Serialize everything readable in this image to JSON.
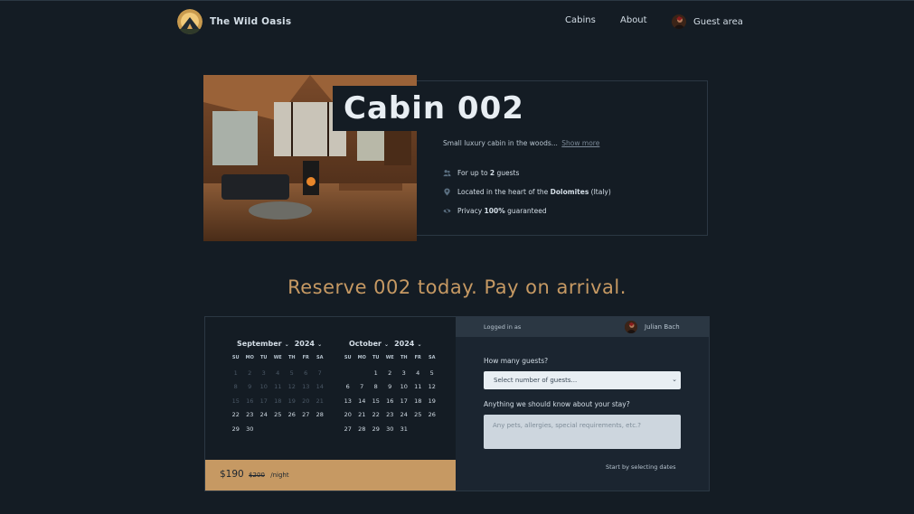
{
  "header": {
    "app_name": "The Wild Oasis",
    "nav": [
      "Cabins",
      "About"
    ],
    "guest_area": "Guest area"
  },
  "cabin": {
    "name": "Cabin 002",
    "description": "Small luxury cabin in the woods...",
    "show_more": "Show more",
    "features": [
      {
        "icon": "users-icon",
        "pre": "For up to ",
        "bold": "2",
        "post": " guests"
      },
      {
        "icon": "map-pin-icon",
        "pre": "Located in the heart of the ",
        "bold": "Dolomites",
        "post": " (Italy)"
      },
      {
        "icon": "eye-slash-icon",
        "pre": "Privacy ",
        "bold": "100%",
        "post": " guaranteed"
      }
    ]
  },
  "reserve_heading": "Reserve 002 today. Pay on arrival.",
  "calendar": {
    "weekdays": [
      "SU",
      "MO",
      "TU",
      "WE",
      "TH",
      "FR",
      "SA"
    ],
    "months": [
      {
        "month": "September",
        "year": "2024",
        "rows": [
          [
            "1",
            "2",
            "3",
            "4",
            "5",
            "6",
            "7"
          ],
          [
            "8",
            "9",
            "10",
            "11",
            "12",
            "13",
            "14"
          ],
          [
            "15",
            "16",
            "17",
            "18",
            "19",
            "20",
            "21"
          ],
          [
            "22",
            "23",
            "24",
            "25",
            "26",
            "27",
            "28"
          ],
          [
            "29",
            "30",
            "",
            "",
            "",
            "",
            ""
          ]
        ],
        "past_until": 21
      },
      {
        "month": "October",
        "year": "2024",
        "rows": [
          [
            "",
            "",
            "1",
            "2",
            "3",
            "4",
            "5"
          ],
          [
            "6",
            "7",
            "8",
            "9",
            "10",
            "11",
            "12"
          ],
          [
            "13",
            "14",
            "15",
            "16",
            "17",
            "18",
            "19"
          ],
          [
            "20",
            "21",
            "22",
            "23",
            "24",
            "25",
            "26"
          ],
          [
            "27",
            "28",
            "29",
            "30",
            "31",
            "",
            ""
          ]
        ],
        "past_until": 0
      }
    ]
  },
  "price": {
    "current": "$190",
    "original": "$200",
    "unit": "/night"
  },
  "form": {
    "logged_in_label": "Logged in as",
    "user_name": "Julian Bach",
    "guests_label": "How many guests?",
    "guests_placeholder": "Select number of guests...",
    "notes_label": "Anything we should know about your stay?",
    "notes_placeholder": "Any pets, allergies, special requirements, etc.?",
    "start_note": "Start by selecting dates"
  },
  "colors": {
    "background": "#141c24",
    "accent": "#c69963",
    "panel": "#1b2530"
  }
}
